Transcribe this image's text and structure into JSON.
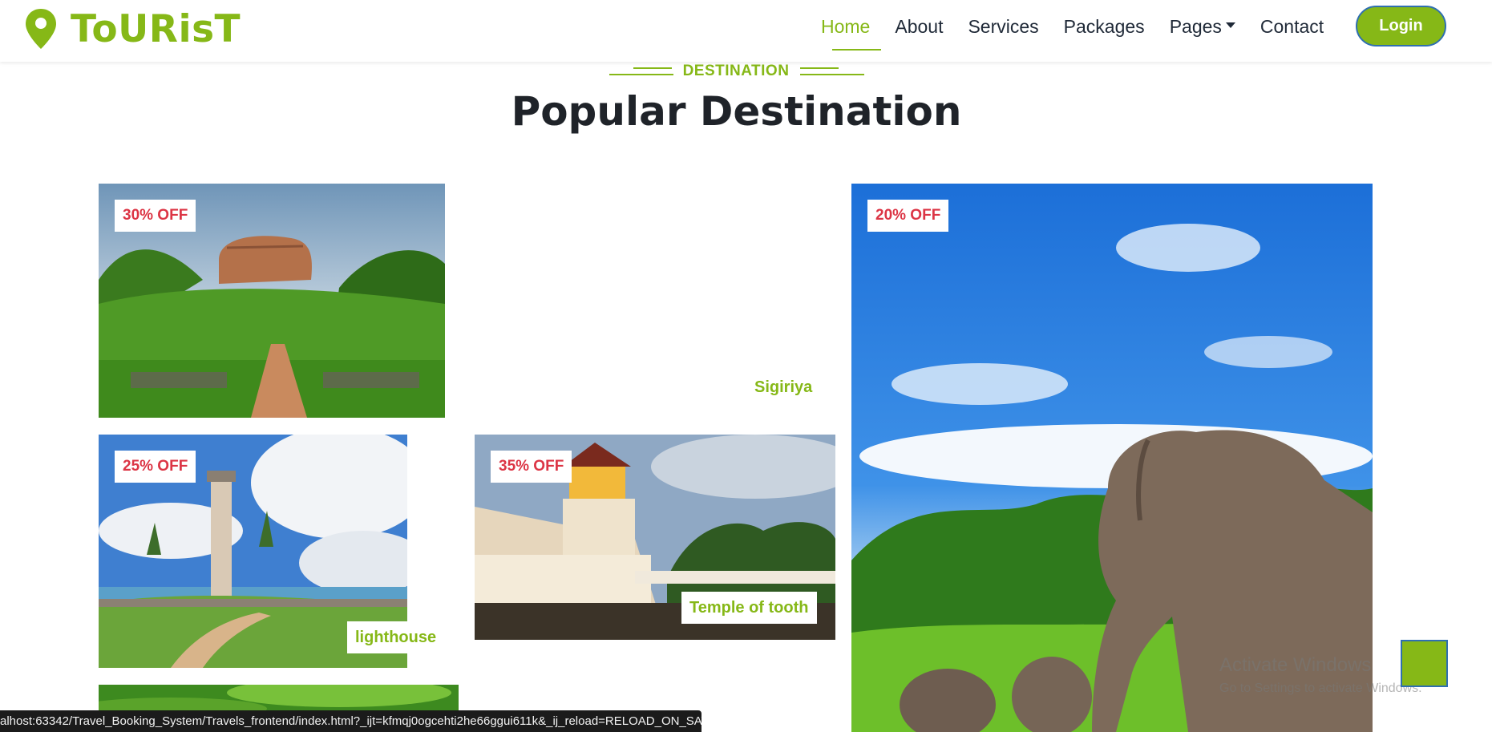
{
  "brand": {
    "name": "ToURisT",
    "icon": "map-pin-icon"
  },
  "nav": {
    "items": [
      {
        "label": "Home",
        "active": true
      },
      {
        "label": "About"
      },
      {
        "label": "Services"
      },
      {
        "label": "Packages"
      },
      {
        "label": "Pages",
        "dropdown": true
      },
      {
        "label": "Contact"
      }
    ],
    "login_label": "Login"
  },
  "section": {
    "eyebrow": "DESTINATION",
    "title": "Popular Destination"
  },
  "destinations": [
    {
      "discount": "30% OFF",
      "name": "Sigiriya"
    },
    {
      "discount": "25% OFF",
      "name": "lighthouse"
    },
    {
      "discount": "35% OFF",
      "name": "Temple of tooth"
    },
    {
      "discount": "20% OFF",
      "name": ""
    }
  ],
  "overlays": {
    "activate_title": "Activate Windows",
    "activate_sub": "Go to Settings to activate Windows.",
    "status_url": "alhost:63342/Travel_Booking_System/Travels_frontend/index.html?_ijt=kfmqj0ogcehti2he66ggui611k&_ij_reload=RELOAD_ON_SAVE"
  },
  "colors": {
    "accent": "#86b817",
    "discount": "#dc3545",
    "heading": "#1f2329"
  }
}
